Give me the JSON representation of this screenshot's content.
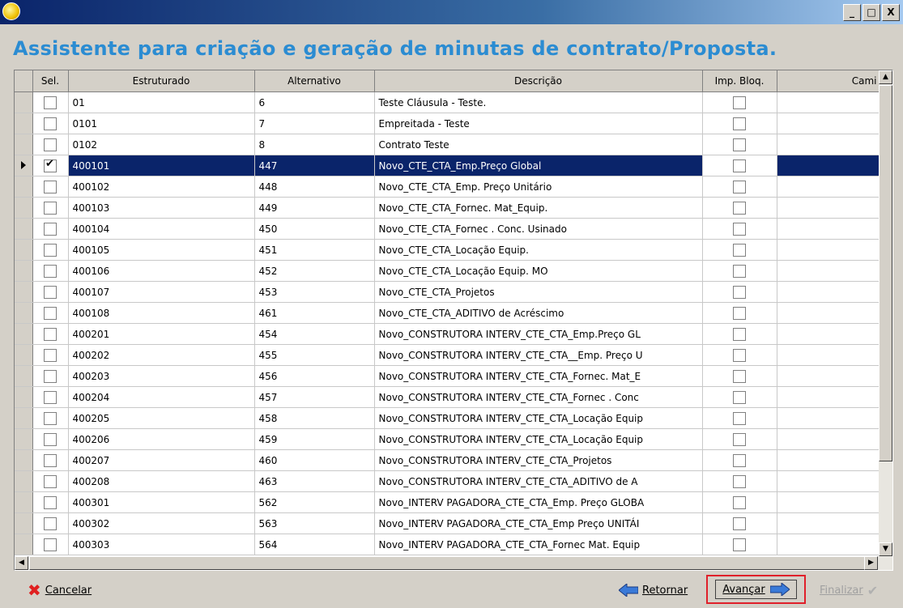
{
  "window": {
    "minimize": "_",
    "maximize": "□",
    "close": "X"
  },
  "heading": "Assistente para criação e geração de minutas de contrato/Proposta.",
  "grid": {
    "columns": [
      "Sel.",
      "Estruturado",
      "Alternativo",
      "Descrição",
      "Imp. Bloq.",
      "Cami"
    ],
    "rows": [
      {
        "sel": false,
        "estruturado": "01",
        "alternativo": "6",
        "descricao": "Teste Cláusula - Teste.",
        "imp": false
      },
      {
        "sel": false,
        "estruturado": "0101",
        "alternativo": "7",
        "descricao": "Empreitada - Teste",
        "imp": false
      },
      {
        "sel": false,
        "estruturado": "0102",
        "alternativo": "8",
        "descricao": "Contrato Teste",
        "imp": false
      },
      {
        "sel": true,
        "estruturado": "400101",
        "alternativo": "447",
        "descricao": "Novo_CTE_CTA_Emp.Preço Global",
        "imp": false,
        "current": true
      },
      {
        "sel": false,
        "estruturado": "400102",
        "alternativo": "448",
        "descricao": "Novo_CTE_CTA_Emp. Preço Unitário",
        "imp": false
      },
      {
        "sel": false,
        "estruturado": "400103",
        "alternativo": "449",
        "descricao": "Novo_CTE_CTA_Fornec. Mat_Equip.",
        "imp": false
      },
      {
        "sel": false,
        "estruturado": "400104",
        "alternativo": "450",
        "descricao": "Novo_CTE_CTA_Fornec . Conc. Usinado",
        "imp": false
      },
      {
        "sel": false,
        "estruturado": "400105",
        "alternativo": "451",
        "descricao": "Novo_CTE_CTA_Locação Equip.",
        "imp": false
      },
      {
        "sel": false,
        "estruturado": "400106",
        "alternativo": "452",
        "descricao": "Novo_CTE_CTA_Locação Equip. MO",
        "imp": false
      },
      {
        "sel": false,
        "estruturado": "400107",
        "alternativo": "453",
        "descricao": "Novo_CTE_CTA_Projetos",
        "imp": false
      },
      {
        "sel": false,
        "estruturado": "400108",
        "alternativo": "461",
        "descricao": "Novo_CTE_CTA_ADITIVO de Acréscimo",
        "imp": false
      },
      {
        "sel": false,
        "estruturado": "400201",
        "alternativo": "454",
        "descricao": "Novo_CONSTRUTORA INTERV_CTE_CTA_Emp.Preço GL",
        "imp": false
      },
      {
        "sel": false,
        "estruturado": "400202",
        "alternativo": "455",
        "descricao": "Novo_CONSTRUTORA INTERV_CTE_CTA__Emp. Preço U",
        "imp": false
      },
      {
        "sel": false,
        "estruturado": "400203",
        "alternativo": "456",
        "descricao": "Novo_CONSTRUTORA INTERV_CTE_CTA_Fornec. Mat_E",
        "imp": false
      },
      {
        "sel": false,
        "estruturado": "400204",
        "alternativo": "457",
        "descricao": "Novo_CONSTRUTORA INTERV_CTE_CTA_Fornec . Conc",
        "imp": false
      },
      {
        "sel": false,
        "estruturado": "400205",
        "alternativo": "458",
        "descricao": "Novo_CONSTRUTORA INTERV_CTE_CTA_Locação Equip",
        "imp": false
      },
      {
        "sel": false,
        "estruturado": "400206",
        "alternativo": "459",
        "descricao": "Novo_CONSTRUTORA INTERV_CTE_CTA_Locação Equip",
        "imp": false
      },
      {
        "sel": false,
        "estruturado": "400207",
        "alternativo": "460",
        "descricao": "Novo_CONSTRUTORA INTERV_CTE_CTA_Projetos",
        "imp": false
      },
      {
        "sel": false,
        "estruturado": "400208",
        "alternativo": "463",
        "descricao": "Novo_CONSTRUTORA INTERV_CTE_CTA_ADITIVO de A",
        "imp": false
      },
      {
        "sel": false,
        "estruturado": "400301",
        "alternativo": "562",
        "descricao": "Novo_INTERV PAGADORA_CTE_CTA_Emp. Preço GLOBA",
        "imp": false
      },
      {
        "sel": false,
        "estruturado": "400302",
        "alternativo": "563",
        "descricao": "Novo_INTERV PAGADORA_CTE_CTA_Emp Preço UNITÁI",
        "imp": false
      },
      {
        "sel": false,
        "estruturado": "400303",
        "alternativo": "564",
        "descricao": "Novo_INTERV PAGADORA_CTE_CTA_Fornec Mat. Equip",
        "imp": false
      }
    ]
  },
  "footer": {
    "cancel": "Cancelar",
    "back": "Retornar",
    "next": "Avançar",
    "finish": "Finalizar"
  },
  "colors": {
    "heading": "#2b8cd2",
    "selection": "#0a246a",
    "highlight": "#e0202a"
  }
}
